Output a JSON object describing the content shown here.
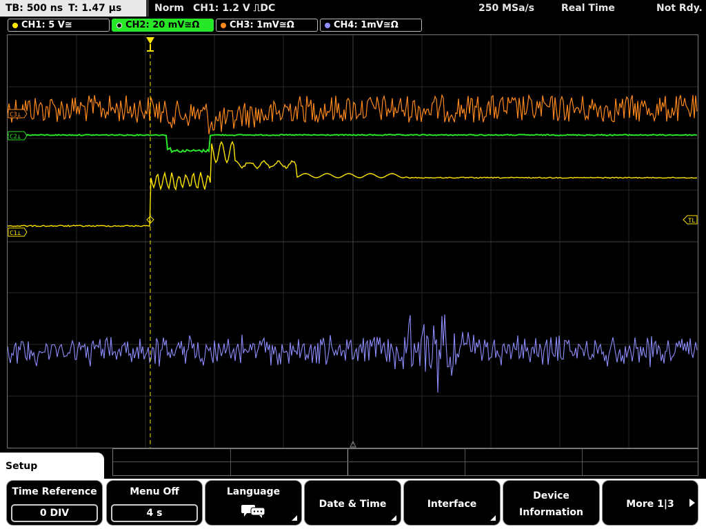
{
  "topbar": {
    "timebase": "TB: 500 ns",
    "trigger_time": "T: 1.47 µs",
    "trigger_mode": "Norm",
    "trigger_info": "CH1: 1.2 V ⎍DC",
    "sample_rate": "250 MSa/s",
    "acq_mode": "Real Time",
    "state": "Not Rdy."
  },
  "channels": [
    {
      "label": "CH1: 5 V≅",
      "color": "#ffe600"
    },
    {
      "label": "CH2: 20 mV≅Ω",
      "color": "#28e628"
    },
    {
      "label": "CH3: 1mV≅Ω",
      "color": "#ff8a1c"
    },
    {
      "label": "CH4: 1mV≅Ω",
      "color": "#8e8eff"
    }
  ],
  "screen_markers": {
    "c3": "C3⊥",
    "c2": "C2⊥",
    "c1": "C1⊥",
    "trigger_level": "TL"
  },
  "menu": {
    "section": "Setup",
    "softkeys": [
      {
        "title": "Time Reference",
        "value": "0 DIV"
      },
      {
        "title": "Menu Off",
        "value": "4 s"
      },
      {
        "title": "Language",
        "icon": "speech-bubbles-icon"
      },
      {
        "title": "Date & Time"
      },
      {
        "title": "Interface"
      },
      {
        "title": "Device\nInformation",
        "title_line1": "Device",
        "title_line2": "Information"
      },
      {
        "title": "More 1|3"
      }
    ]
  }
}
